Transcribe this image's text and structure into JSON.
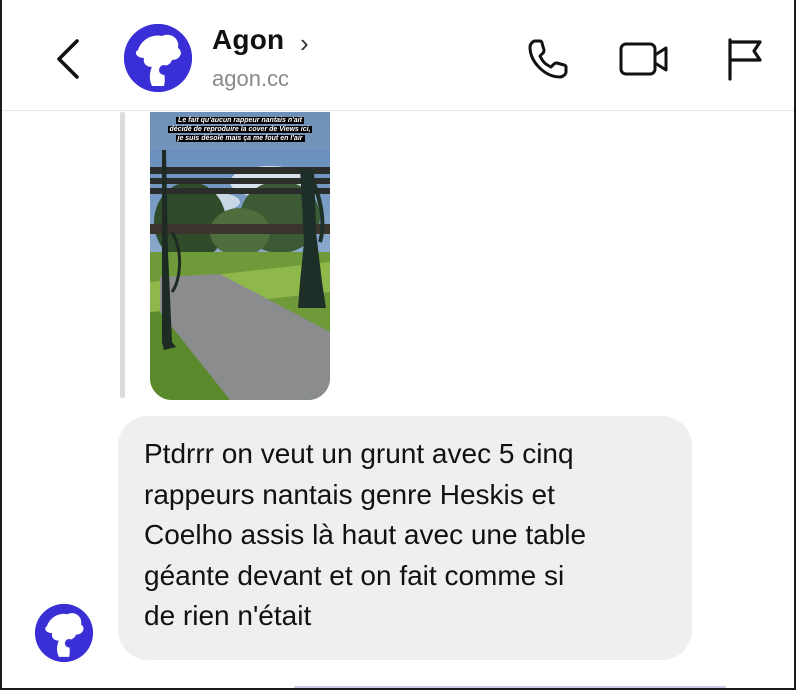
{
  "header": {
    "back_icon": "chevron-left-icon",
    "contact_name": "Agon",
    "contact_chevron": "›",
    "contact_handle": "agon.cc",
    "actions": [
      {
        "icon": "phone-icon"
      },
      {
        "icon": "video-camera-icon"
      },
      {
        "icon": "flag-icon"
      }
    ]
  },
  "thread": {
    "story_reply": {
      "caption_lines": [
        "Le fait qu'aucun rappeur nantais n'ait",
        "décidé de reproduire la cover de Views ici,",
        "je suis désolé mais ça me fout en l'air"
      ]
    },
    "message": {
      "text": "Ptdrrr on veut un grunt avec 5 cinq\nrappeurs nantais genre Heskis et\nCoelho assis là haut avec une table\ngéante devant et on fait comme si\nde rien n'était"
    }
  },
  "colors": {
    "avatar_bg": "#3a2fd6",
    "bubble_bg": "#efefef",
    "handle_text": "#8a8a8a"
  }
}
